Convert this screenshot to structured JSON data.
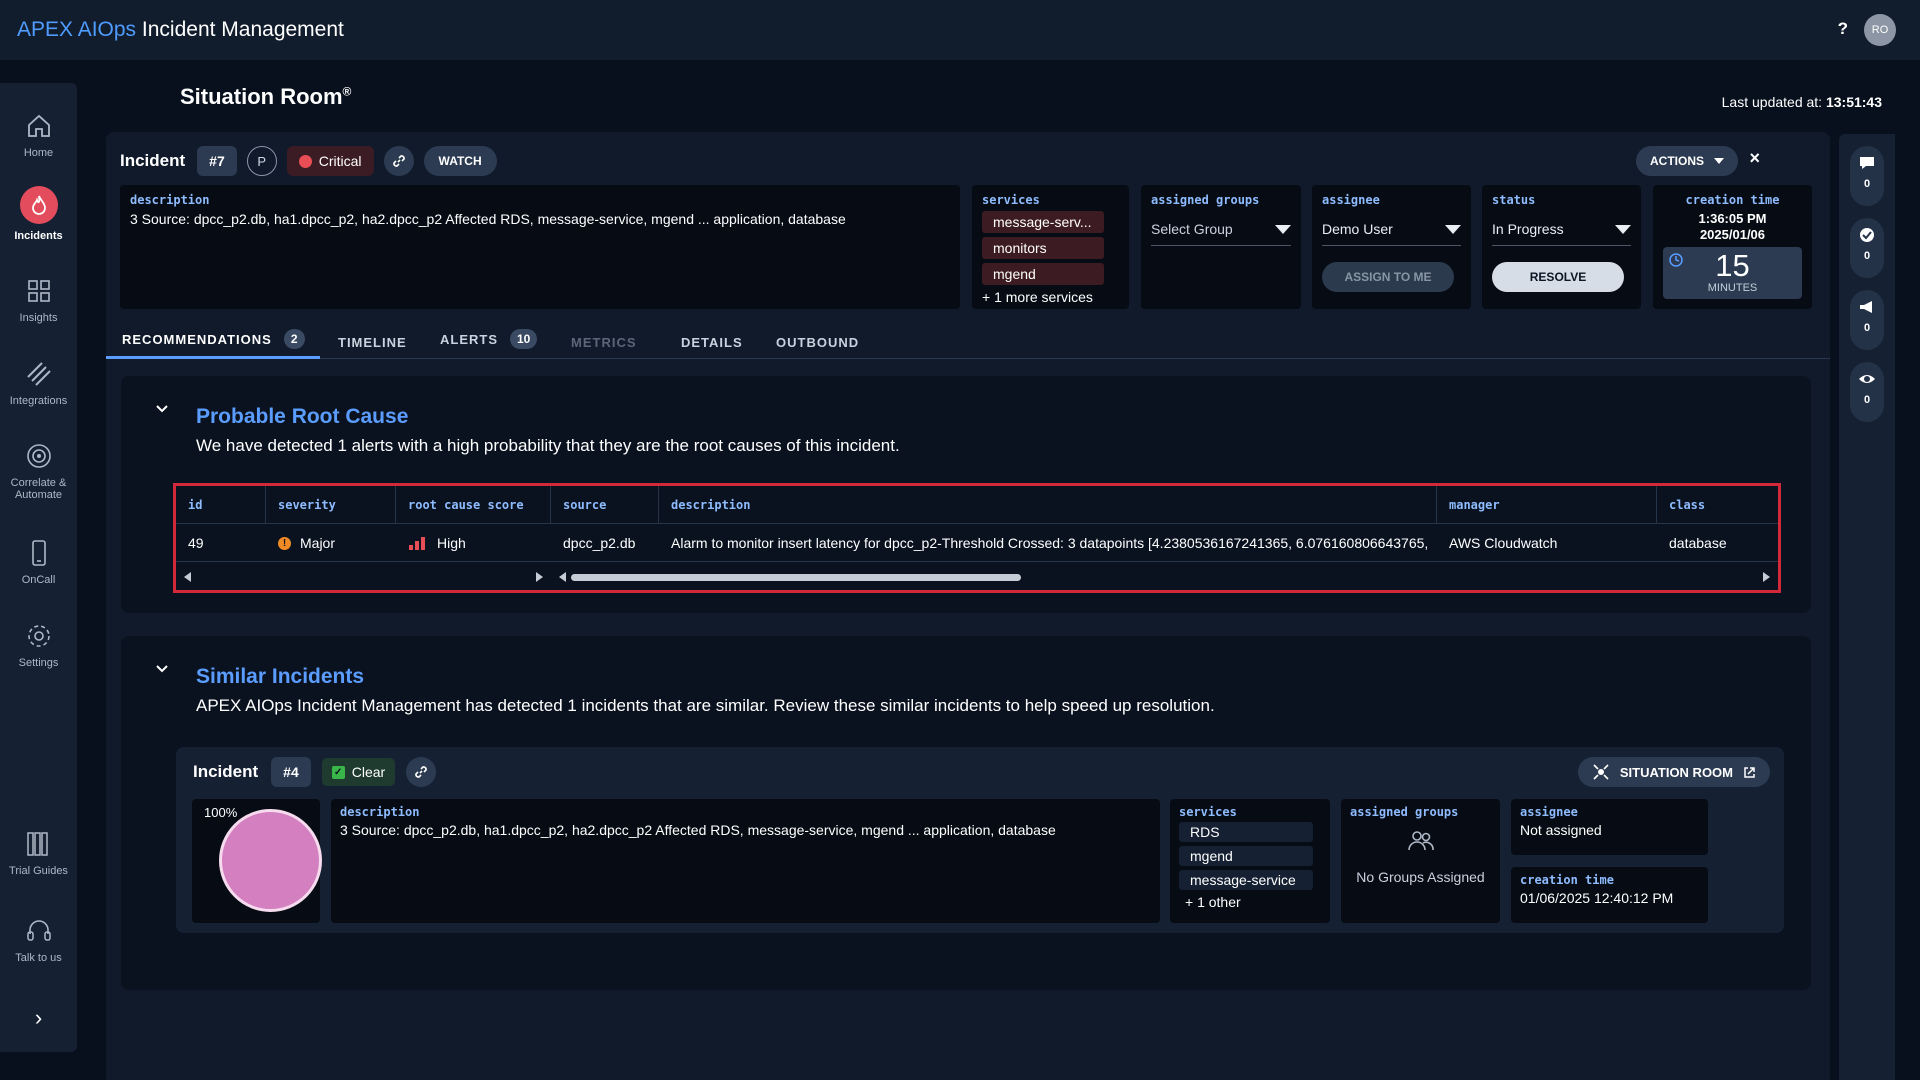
{
  "app": {
    "brand_part1": "APEX AIOps",
    "brand_part2": "Incident Management",
    "help": "?",
    "avatar": "RO"
  },
  "nav": {
    "items": [
      {
        "label": "Home",
        "icon": "home-icon"
      },
      {
        "label": "Incidents",
        "icon": "flame-icon",
        "active": true
      },
      {
        "label": "Insights",
        "icon": "dashboard-icon"
      },
      {
        "label": "Integrations",
        "icon": "plug-icon"
      },
      {
        "label": "Correlate & Automate",
        "icon": "target-icon"
      },
      {
        "label": "OnCall",
        "icon": "phone-icon"
      },
      {
        "label": "Settings",
        "icon": "gear-icon"
      },
      {
        "label": "Trial Guides",
        "icon": "books-icon"
      },
      {
        "label": "Talk to us",
        "icon": "headset-icon"
      }
    ],
    "expand": "›"
  },
  "rail": {
    "counts": [
      "0",
      "0",
      "0",
      "0"
    ]
  },
  "header": {
    "title": "Situation Room",
    "title_mark": "®",
    "last_updated_label": "Last updated at:",
    "last_updated_value": "13:51:43"
  },
  "incident": {
    "label": "Incident",
    "number": "#7",
    "priority": "P",
    "severity": "Critical",
    "watch": "WATCH",
    "actions": "ACTIONS",
    "close": "×",
    "description_label": "description",
    "description": "3 Source: dpcc_p2.db, ha1.dpcc_p2, ha2.dpcc_p2 Affected RDS, message-service, mgend ... application, database",
    "services_label": "services",
    "services": [
      "message-serv...",
      "monitors",
      "mgend"
    ],
    "services_more": "+ 1 more services",
    "groups_label": "assigned groups",
    "groups_placeholder": "Select Group",
    "assignee_label": "assignee",
    "assignee": "Demo User",
    "assign_to_me": "ASSIGN TO ME",
    "status_label": "status",
    "status": "In Progress",
    "resolve": "RESOLVE",
    "creation_label": "creation time",
    "creation_time": "1:36:05 PM",
    "creation_date": "2025/01/06",
    "timer_value": "15",
    "timer_unit": "MINUTES"
  },
  "tabs": [
    {
      "label": "RECOMMENDATIONS",
      "badge": "2"
    },
    {
      "label": "TIMELINE"
    },
    {
      "label": "ALERTS",
      "badge": "10"
    },
    {
      "label": "METRICS"
    },
    {
      "label": "DETAILS"
    },
    {
      "label": "OUTBOUND"
    }
  ],
  "root_cause": {
    "title": "Probable Root Cause",
    "subtitle": "We have detected 1 alerts with a high probability that they are the root causes of this incident.",
    "columns": [
      "id",
      "severity",
      "root cause score",
      "source",
      "description",
      "manager",
      "class"
    ],
    "row": {
      "id": "49",
      "severity": "Major",
      "score": "High",
      "source": "dpcc_p2.db",
      "description": "Alarm to monitor insert latency for dpcc_p2-Threshold Crossed: 3 datapoints [4.2380536167241365, 6.076160806643765,",
      "manager": "AWS Cloudwatch",
      "class": "database"
    }
  },
  "similar": {
    "title": "Similar Incidents",
    "subtitle": "APEX AIOps Incident Management has detected 1 incidents that are similar. Review these similar incidents to help speed up resolution.",
    "incident_label": "Incident",
    "number": "#4",
    "status": "Clear",
    "situation_room": "SITUATION ROOM",
    "similarity": "100%",
    "description_label": "description",
    "description": "3 Source: dpcc_p2.db, ha1.dpcc_p2, ha2.dpcc_p2 Affected RDS, message-service, mgend ... application, database",
    "services_label": "services",
    "services": [
      "RDS",
      "mgend",
      "message-service"
    ],
    "services_more": "+ 1 other",
    "groups_label": "assigned groups",
    "groups_empty": "No Groups Assigned",
    "assignee_label": "assignee",
    "assignee": "Not assigned",
    "creation_label": "creation time",
    "creation_time": "01/06/2025 12:40:12 PM"
  },
  "colors": {
    "accent": "#5b9dff",
    "critical": "#e94d56",
    "major": "#f08a24",
    "clear": "#39b54a",
    "highlight_border": "#d2283a",
    "similarity_disc": "#d47fbf"
  }
}
